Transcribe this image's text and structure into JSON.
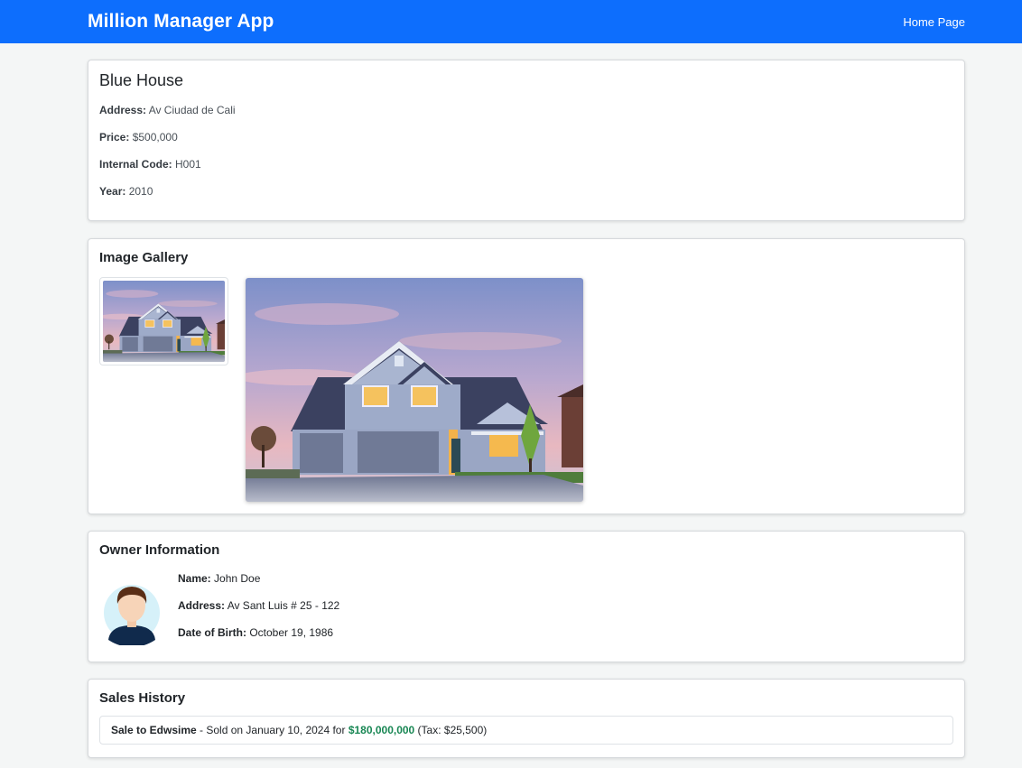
{
  "app": {
    "brand": "Million Manager App",
    "nav_home": "Home Page"
  },
  "property": {
    "name": "Blue House",
    "address_label": "Address:",
    "address": "Av Ciudad de Cali",
    "price_label": "Price:",
    "price": "$500,000",
    "code_label": "Internal Code:",
    "code": "H001",
    "year_label": "Year:",
    "year": "2010"
  },
  "gallery": {
    "title": "Image Gallery",
    "images": [
      "house-thumbnail",
      "house-main-photo"
    ]
  },
  "owner": {
    "title": "Owner Information",
    "name_label": "Name:",
    "name": "John Doe",
    "address_label": "Address:",
    "address": "Av Sant Luis # 25 - 122",
    "dob_label": "Date of Birth:",
    "dob": "October 19, 1986"
  },
  "sales": {
    "title": "Sales History",
    "items": [
      {
        "buyer": "Sale to Edwsime",
        "date_text": " - Sold on January 10, 2024 for ",
        "price": "$180,000,000",
        "tax": " (Tax: $25,500)"
      }
    ]
  },
  "colors": {
    "primary": "#0d6efd",
    "success": "#198754",
    "background": "#f4f6f6"
  }
}
